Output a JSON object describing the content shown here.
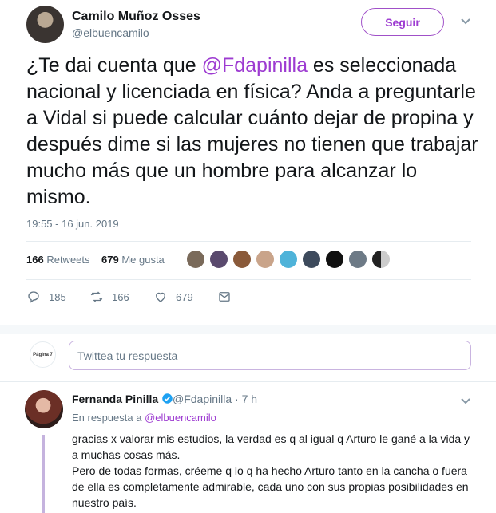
{
  "tweet": {
    "author_name": "Camilo Muñoz Osses",
    "author_handle": "@elbuencamilo",
    "follow_label": "Seguir",
    "text_pre": "¿Te dai cuenta que ",
    "text_mention": "@Fdapinilla",
    "text_post": " es seleccionada nacional y licenciada en física? Anda a preguntarle a Vidal si puede calcular cuánto dejar de propina y después dime si las mujeres no tienen que trabajar mucho más que un hombre para alcanzar lo mismo.",
    "timestamp": "19:55 - 16 jun. 2019",
    "retweets_count": "166",
    "retweets_label": "Retweets",
    "likes_count": "679",
    "likes_label": "Me gusta",
    "actions": {
      "replies": "185",
      "retweets": "166",
      "likes": "679"
    }
  },
  "reply_composer": {
    "avatar_label": "Página 7",
    "placeholder": "Twittea tu respuesta"
  },
  "reply": {
    "author_name": "Fernanda Pinilla",
    "author_handle": "@Fdapinilla",
    "time": "· 7 h",
    "replying_prefix": "En respuesta a ",
    "replying_handle": "@elbuencamilo",
    "text": "gracias x valorar mis estudios, la verdad es q al igual q Arturo le gané a la vida y a muchas cosas más.\nPero de todas formas, créeme q lo q ha hecho Arturo tanto en la cancha o fuera de ella es completamente admirable, cada uno con sus propias posibilidades en nuestro país."
  },
  "colors": {
    "accent": "#9d3bd1",
    "muted": "#657786",
    "verified": "#1da1f2"
  },
  "icons": [
    "chevron-down-icon",
    "reply-icon",
    "retweet-icon",
    "like-icon",
    "message-icon",
    "verified-icon"
  ]
}
